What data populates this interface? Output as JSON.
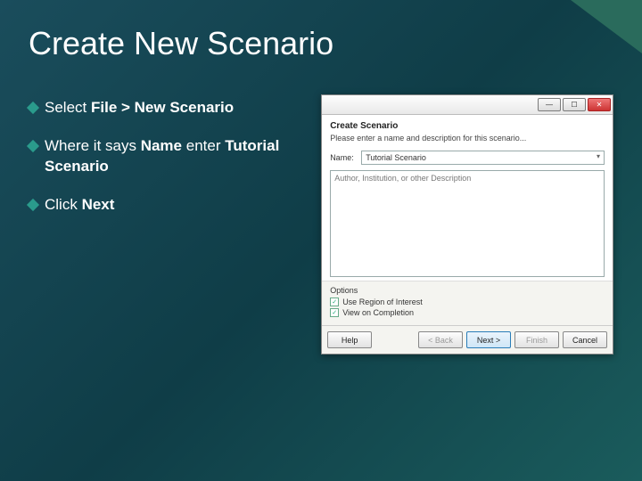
{
  "slide": {
    "title": "Create New Scenario",
    "bullets": [
      {
        "prefix": "Select ",
        "bold1": "File > New Scenario",
        "mid": "",
        "bold2": "",
        "tail": ""
      },
      {
        "prefix": "Where it says ",
        "bold1": "Name",
        "mid": " enter ",
        "bold2": "Tutorial Scenario",
        "tail": ""
      },
      {
        "prefix": "Click ",
        "bold1": "Next",
        "mid": "",
        "bold2": "",
        "tail": ""
      }
    ]
  },
  "dialog": {
    "window": {
      "min_glyph": "—",
      "max_glyph": "☐",
      "close_glyph": "✕"
    },
    "heading": "Create Scenario",
    "subheading": "Please enter a name and description for this scenario...",
    "name_label": "Name:",
    "name_value": "Tutorial Scenario",
    "desc_placeholder": "Author, Institution, or other Description",
    "options_title": "Options",
    "opt_roi": "Use Region of Interest",
    "opt_voc": "View on Completion",
    "buttons": {
      "help": "Help",
      "back": "< Back",
      "next": "Next >",
      "finish": "Finish",
      "cancel": "Cancel"
    }
  }
}
